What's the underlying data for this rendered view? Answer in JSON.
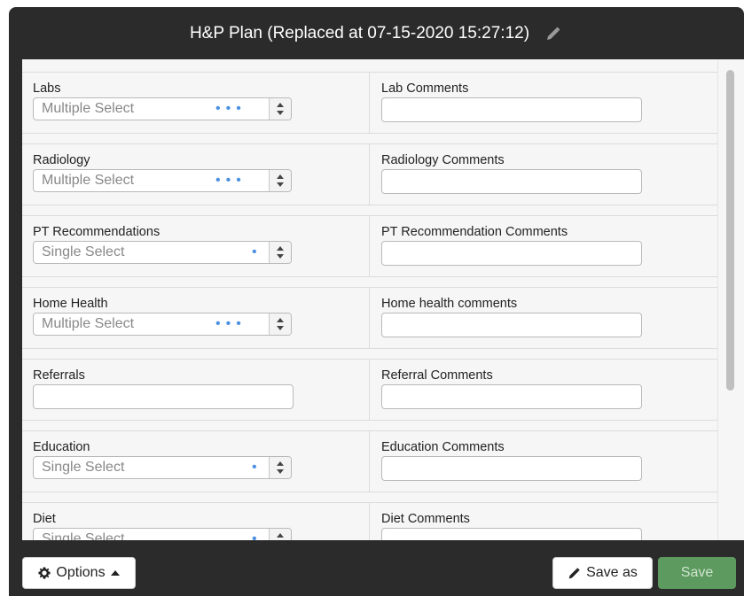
{
  "dialog": {
    "title": "H&P Plan (Replaced at 07-15-2020 15:27:12)"
  },
  "rows": [
    {
      "left_label": "Labs",
      "left_type": "multiple",
      "left_value": "Multiple Select",
      "right_label": "Lab Comments"
    },
    {
      "left_label": "Radiology",
      "left_type": "multiple",
      "left_value": "Multiple Select",
      "right_label": "Radiology Comments"
    },
    {
      "left_label": "PT Recommendations",
      "left_type": "single",
      "left_value": "Single Select",
      "right_label": "PT Recommendation Comments"
    },
    {
      "left_label": "Home Health",
      "left_type": "multiple",
      "left_value": "Multiple Select",
      "right_label": "Home health comments"
    },
    {
      "left_label": "Referrals",
      "left_type": "text",
      "left_value": "",
      "right_label": "Referral Comments"
    },
    {
      "left_label": "Education",
      "left_type": "single",
      "left_value": "Single Select",
      "right_label": "Education Comments"
    },
    {
      "left_label": "Diet",
      "left_type": "single",
      "left_value": "Single Select",
      "right_label": "Diet Comments"
    }
  ],
  "footer": {
    "options_label": "Options",
    "save_as_label": "Save as",
    "save_label": "Save"
  },
  "colors": {
    "header_bg": "#2b2b2b",
    "dot_blue": "#4a90e2",
    "save_green": "#5c9a5f"
  },
  "icons": {
    "title": "pencil-icon",
    "options": "gear-icon",
    "options_caret": "caret-up-icon",
    "save_as": "pencil-icon",
    "select_stepper": "up-down-arrows-icon"
  }
}
